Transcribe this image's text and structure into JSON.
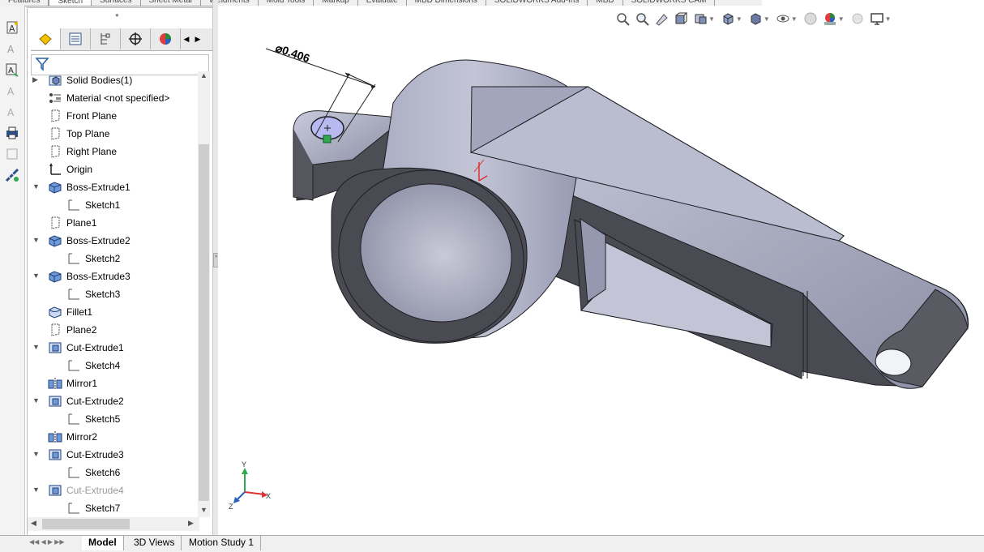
{
  "ribbon": {
    "tabs": [
      "Features",
      "Sketch",
      "Surfaces",
      "Sheet Metal",
      "Weldments",
      "Mold Tools",
      "Markup",
      "Evaluate",
      "MBD Dimensions",
      "SOLIDWORKS Add-Ins",
      "MBD",
      "SOLIDWORKS CAM"
    ],
    "active": "Sketch"
  },
  "feature_tree": {
    "items": [
      {
        "label": "Solid Bodies(1)",
        "icon": "solid-bodies-folder-icon",
        "expander": "collapsed",
        "indent": 0
      },
      {
        "label": "Material <not specified>",
        "icon": "material-icon",
        "expander": "none",
        "indent": 0
      },
      {
        "label": "Front Plane",
        "icon": "plane-icon",
        "expander": "none",
        "indent": 0
      },
      {
        "label": "Top Plane",
        "icon": "plane-icon",
        "expander": "none",
        "indent": 0
      },
      {
        "label": "Right Plane",
        "icon": "plane-icon",
        "expander": "none",
        "indent": 0
      },
      {
        "label": "Origin",
        "icon": "origin-icon",
        "expander": "none",
        "indent": 0
      },
      {
        "label": "Boss-Extrude1",
        "icon": "boss-extrude-icon",
        "expander": "expanded",
        "indent": 0
      },
      {
        "label": "Sketch1",
        "icon": "sketch-icon",
        "expander": "none",
        "indent": 1
      },
      {
        "label": "Plane1",
        "icon": "plane-icon",
        "expander": "none",
        "indent": 0
      },
      {
        "label": "Boss-Extrude2",
        "icon": "boss-extrude-icon",
        "expander": "expanded",
        "indent": 0
      },
      {
        "label": "Sketch2",
        "icon": "sketch-icon",
        "expander": "none",
        "indent": 1
      },
      {
        "label": "Boss-Extrude3",
        "icon": "boss-extrude-icon",
        "expander": "expanded",
        "indent": 0
      },
      {
        "label": "Sketch3",
        "icon": "sketch-icon",
        "expander": "none",
        "indent": 1
      },
      {
        "label": "Fillet1",
        "icon": "fillet-icon",
        "expander": "none",
        "indent": 0
      },
      {
        "label": "Plane2",
        "icon": "plane-icon",
        "expander": "none",
        "indent": 0
      },
      {
        "label": "Cut-Extrude1",
        "icon": "cut-extrude-icon",
        "expander": "expanded",
        "indent": 0
      },
      {
        "label": "Sketch4",
        "icon": "sketch-icon",
        "expander": "none",
        "indent": 1
      },
      {
        "label": "Mirror1",
        "icon": "mirror-icon",
        "expander": "none",
        "indent": 0
      },
      {
        "label": "Cut-Extrude2",
        "icon": "cut-extrude-icon",
        "expander": "expanded",
        "indent": 0
      },
      {
        "label": "Sketch5",
        "icon": "sketch-icon",
        "expander": "none",
        "indent": 1
      },
      {
        "label": "Mirror2",
        "icon": "mirror-icon",
        "expander": "none",
        "indent": 0
      },
      {
        "label": "Cut-Extrude3",
        "icon": "cut-extrude-icon",
        "expander": "expanded",
        "indent": 0
      },
      {
        "label": "Sketch6",
        "icon": "sketch-icon",
        "expander": "none",
        "indent": 1
      },
      {
        "label": "Cut-Extrude4",
        "icon": "cut-extrude-icon",
        "expander": "expanded",
        "indent": 0,
        "dim": true
      },
      {
        "label": "Sketch7",
        "icon": "sketch-icon",
        "expander": "none",
        "indent": 1
      }
    ]
  },
  "bottom_tabs": [
    "Model",
    "3D Views",
    "Motion Study 1"
  ],
  "bottom_active": "Model",
  "viewport": {
    "dimension_text": "⌀0.406",
    "triad": {
      "x": "X",
      "y": "Y",
      "z": "Z"
    },
    "colors": {
      "part_face": "#a9abc1",
      "part_dark": "#4a4a52",
      "accent_green": "#2fa84f",
      "accent_red": "#e03030"
    }
  }
}
